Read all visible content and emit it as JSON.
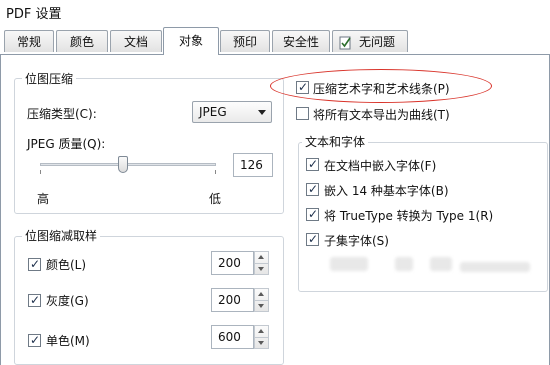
{
  "window": {
    "title": "PDF 设置"
  },
  "tabs": [
    {
      "label": "常规"
    },
    {
      "label": "颜色"
    },
    {
      "label": "文档"
    },
    {
      "label": "对象"
    },
    {
      "label": "预印"
    },
    {
      "label": "安全性"
    },
    {
      "label": "无问题"
    }
  ],
  "bitmap_compression": {
    "title": "位图压缩",
    "type_label": "压缩类型(C):",
    "type_value": "JPEG",
    "quality_label": "JPEG 质量(Q):",
    "quality_value": "126",
    "slider_fraction": 0.47,
    "high_label": "高",
    "low_label": "低"
  },
  "options": {
    "compress_art": {
      "label": "压缩艺术字和艺术线条(P)",
      "checked": true
    },
    "export_curves": {
      "label": "将所有文本导出为曲线(T)",
      "checked": false
    }
  },
  "text_fonts": {
    "title": "文本和字体",
    "items": [
      {
        "label": "在文档中嵌入字体(F)",
        "checked": true
      },
      {
        "label": "嵌入 14 种基本字体(B)",
        "checked": true
      },
      {
        "label": "将 TrueType 转换为 Type 1(R)",
        "checked": true
      },
      {
        "label": "子集字体(S)",
        "checked": true
      }
    ]
  },
  "downsample": {
    "title": "位图缩减取样",
    "rows": [
      {
        "label": "颜色(L)",
        "checked": true,
        "value": "200"
      },
      {
        "label": "灰度(G)",
        "checked": true,
        "value": "200"
      },
      {
        "label": "单色(M)",
        "checked": true,
        "value": "600"
      }
    ]
  },
  "colors": {
    "highlight": "#d9342b",
    "check": "#1b2d4a"
  }
}
